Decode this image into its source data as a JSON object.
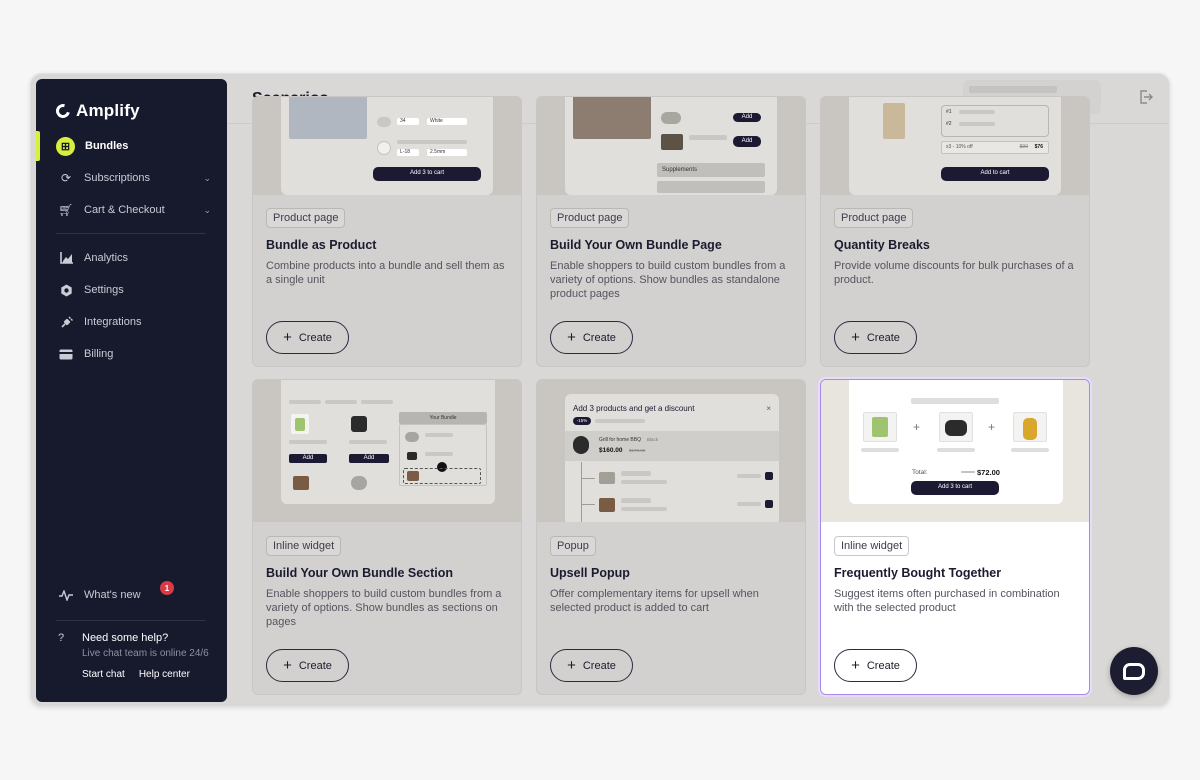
{
  "app": {
    "name": "Amplify"
  },
  "sidebar": {
    "items": [
      {
        "label": "Bundles",
        "icon": "bundles-icon",
        "active": true
      },
      {
        "label": "Subscriptions",
        "icon": "refresh-icon",
        "expandable": true
      },
      {
        "label": "Cart & Checkout",
        "icon": "cart-icon",
        "expandable": true
      },
      {
        "label": "Analytics",
        "icon": "analytics-icon"
      },
      {
        "label": "Settings",
        "icon": "gear-icon"
      },
      {
        "label": "Integrations",
        "icon": "plug-icon"
      },
      {
        "label": "Billing",
        "icon": "card-icon"
      }
    ],
    "whats_new": {
      "label": "What's new",
      "count": "1"
    },
    "help": {
      "title": "Need some help?",
      "subtitle": "Live chat team is online 24/6",
      "start_chat": "Start chat",
      "help_center": "Help center"
    }
  },
  "header": {
    "title": "Scenarios"
  },
  "cards": [
    {
      "tag": "Product page",
      "title": "Bundle as Product",
      "desc": "Combine products into a bundle and sell them as a single unit",
      "button": "Create",
      "preview": {
        "opt1": "34",
        "opt2": "White",
        "opt3": "L-18",
        "opt4": "2.5mm",
        "cta": "Add 3 to cart"
      }
    },
    {
      "tag": "Product page",
      "title": "Build Your Own Bundle Page",
      "desc": "Enable shoppers to build custom bundles from a variety of options. Show bundles as standalone product pages",
      "button": "Create",
      "preview": {
        "add1": "Add",
        "add2": "Add",
        "section": "Supplements"
      }
    },
    {
      "tag": "Product page",
      "title": "Quantity Breaks",
      "desc": "Provide volume discounts for bulk purchases of a product.",
      "button": "Create",
      "preview": {
        "row1": "#1",
        "row2": "#2",
        "offer": "x3 - 10% off",
        "old_price": "$90",
        "price": "$76",
        "cta": "Add to cart"
      }
    },
    {
      "tag": "Inline widget",
      "title": "Build Your Own Bundle Section",
      "desc": "Enable shoppers to build custom bundles from a variety of options. Show bundles as sections on pages",
      "button": "Create",
      "preview": {
        "panel": "Your Bundle",
        "add1": "Add",
        "add2": "Add"
      }
    },
    {
      "tag": "Popup",
      "title": "Upsell Popup",
      "desc": "Offer complementary items for upsell when selected product is added to cart",
      "button": "Create",
      "preview": {
        "heading": "Add 3 products and get a discount",
        "discount": "-15%",
        "product": "Grill for home BBQ",
        "variant": "Black",
        "price": "$160.00",
        "old_price": "$170.00",
        "close": "×"
      }
    },
    {
      "tag": "Inline widget",
      "title": "Frequently Bought Together",
      "desc": "Suggest items often purchased in combination with the selected product",
      "button": "Create",
      "selected": true,
      "preview": {
        "total_label": "Total:",
        "price": "$72.00",
        "cta": "Add 3 to cart"
      }
    }
  ],
  "colors": {
    "sidebar_bg": "#171a2c",
    "accent": "#d9ef3e",
    "selected_border": "#a889e8",
    "notification": "#d83a46"
  }
}
